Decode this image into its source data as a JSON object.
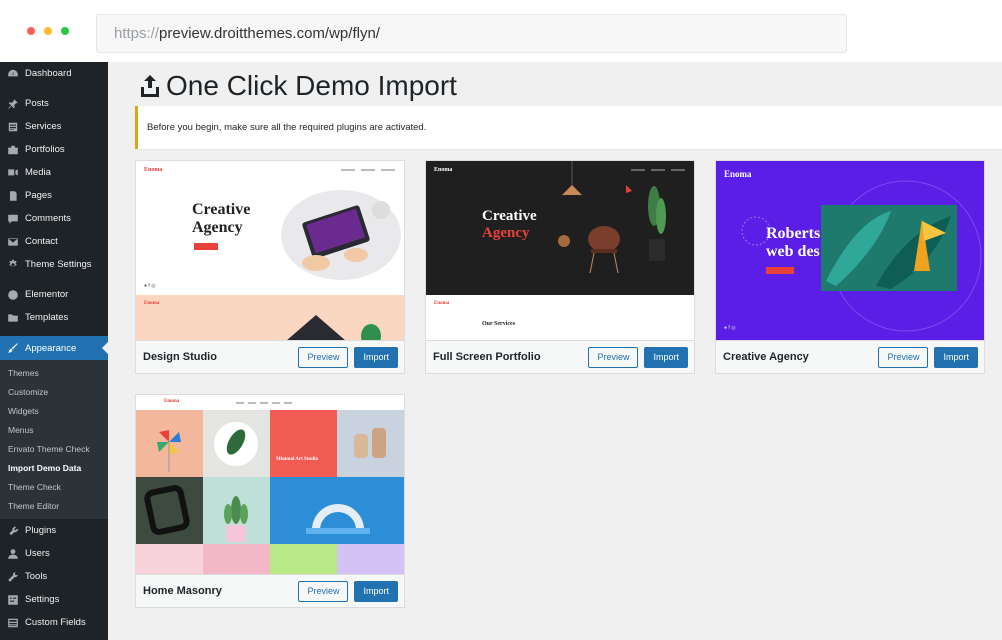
{
  "browser": {
    "url_scheme": "https://",
    "url_rest": "preview.droitthemes.com/wp/flyn/",
    "dot_colors": [
      "#ff5f57",
      "#febc2e",
      "#28c840"
    ]
  },
  "sidebar": {
    "items": [
      {
        "label": "Dashboard",
        "icon": "dashboard-icon"
      },
      {
        "label": "Posts",
        "icon": "pin-icon"
      },
      {
        "label": "Services",
        "icon": "services-icon"
      },
      {
        "label": "Portfolios",
        "icon": "portfolio-icon"
      },
      {
        "label": "Media",
        "icon": "media-icon"
      },
      {
        "label": "Pages",
        "icon": "pages-icon"
      },
      {
        "label": "Comments",
        "icon": "comment-icon"
      },
      {
        "label": "Contact",
        "icon": "mail-icon"
      },
      {
        "label": "Theme Settings",
        "icon": "gear-icon"
      },
      {
        "label": "Elementor",
        "icon": "elementor-icon"
      },
      {
        "label": "Templates",
        "icon": "folder-icon"
      },
      {
        "label": "Appearance",
        "icon": "brush-icon"
      },
      {
        "label": "Plugins",
        "icon": "plugin-icon"
      },
      {
        "label": "Users",
        "icon": "user-icon"
      },
      {
        "label": "Tools",
        "icon": "wrench-icon"
      },
      {
        "label": "Settings",
        "icon": "settings-icon"
      },
      {
        "label": "Custom Fields",
        "icon": "fields-icon"
      }
    ],
    "submenu": [
      "Themes",
      "Customize",
      "Widgets",
      "Menus",
      "Envato Theme Check",
      "Import Demo Data",
      "Theme Check",
      "Theme Editor"
    ]
  },
  "main": {
    "title": "One Click Demo Import",
    "notice": "Before you begin, make sure all the required plugins are activated.",
    "preview_label": "Preview",
    "import_label": "Import",
    "demos": [
      {
        "name": "Design Studio"
      },
      {
        "name": "Full Screen Portfolio"
      },
      {
        "name": "Creative Agency"
      },
      {
        "name": "Home Masonry"
      }
    ],
    "thumbnails": {
      "brand": "Enoma",
      "design_heading_1": "Creative",
      "design_heading_2": "Agency",
      "portfolio_heading_1": "Creative",
      "portfolio_heading_2": "Agency",
      "portfolio_services": "Our Services",
      "agency_heading_1": "Roberts",
      "agency_heading_2": "web des",
      "masonry_caption": "Minimal Art Studio",
      "flyn_overlay": "flyn"
    }
  }
}
